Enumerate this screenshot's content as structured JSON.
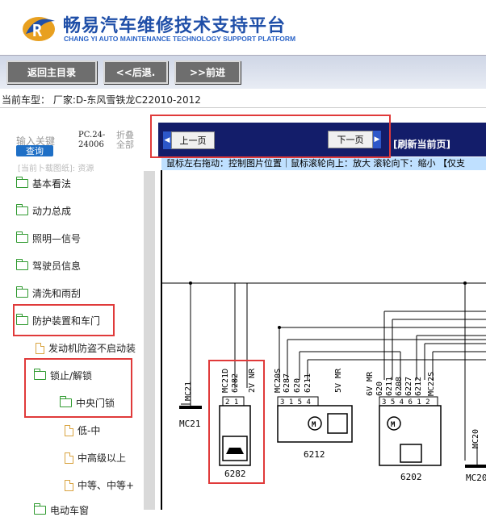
{
  "header": {
    "title_cn": "畅易汽车维修技术支持平台",
    "title_en": "CHANG YI AUTO MAINTENANCE TECHNOLOGY SUPPORT PLATFORM"
  },
  "nav": {
    "home": "返回主目录",
    "back": "<<后退.",
    "forward": ">>前进"
  },
  "vehicle": "当前车型：  厂家:D-东风雪铁龙C22010-2012",
  "search": {
    "label": "输入关键",
    "button": "查询",
    "pc_code_line1": "PC.24-",
    "pc_code_line2": "24006",
    "collapse_line1": "折叠",
    "collapse_line2": "全部"
  },
  "tree": {
    "partial": "[当前卜载图纸]:    资源",
    "items": [
      {
        "label": "基本看法"
      },
      {
        "label": "动力总成"
      },
      {
        "label": "照明—信号"
      },
      {
        "label": "驾驶员信息"
      },
      {
        "label": "清洗和雨刮"
      },
      {
        "label": "防护装置和车门"
      },
      {
        "label": "发动机防盗不启动装"
      },
      {
        "label": "锁止/解锁"
      },
      {
        "label": "中央门锁"
      },
      {
        "label": "低-中"
      },
      {
        "label": "中高级以上"
      },
      {
        "label": "中等、中等+"
      },
      {
        "label": "电动车窗"
      }
    ]
  },
  "viewer": {
    "prev": "上一页",
    "next": "下一页",
    "refresh": "[刷新当前页]",
    "hint": "鼠标左右拖动：控制图片位置｜鼠标滚轮向上：放大  滚轮向下：缩小  【仅支"
  },
  "diagram": {
    "labels": {
      "mc21_left": "MC21",
      "mc21_bottom": "MC21",
      "mc20": "MC20",
      "c6282": "6282",
      "c6212": "6212",
      "c6202": "6202",
      "w_mc21d": "MC21D",
      "w_6282": "6282",
      "w_2vnr": "2V NR",
      "w_mc20s": "MC20S",
      "w_6287": "6287",
      "w_620a": "620",
      "w_6211": "6211",
      "w_5vmr": "5V MR",
      "w_6vmr": "6V MR",
      "w_620b": "620",
      "w_6211b": "6211",
      "w_6208": "6208",
      "w_6227": "6227",
      "w_6212": "6212",
      "w_mc22s": "MC22S",
      "pins_6282": "2 1",
      "pins_6212": "3 1 5 4",
      "pins_6202": "3 5 4 6 1 2"
    }
  }
}
